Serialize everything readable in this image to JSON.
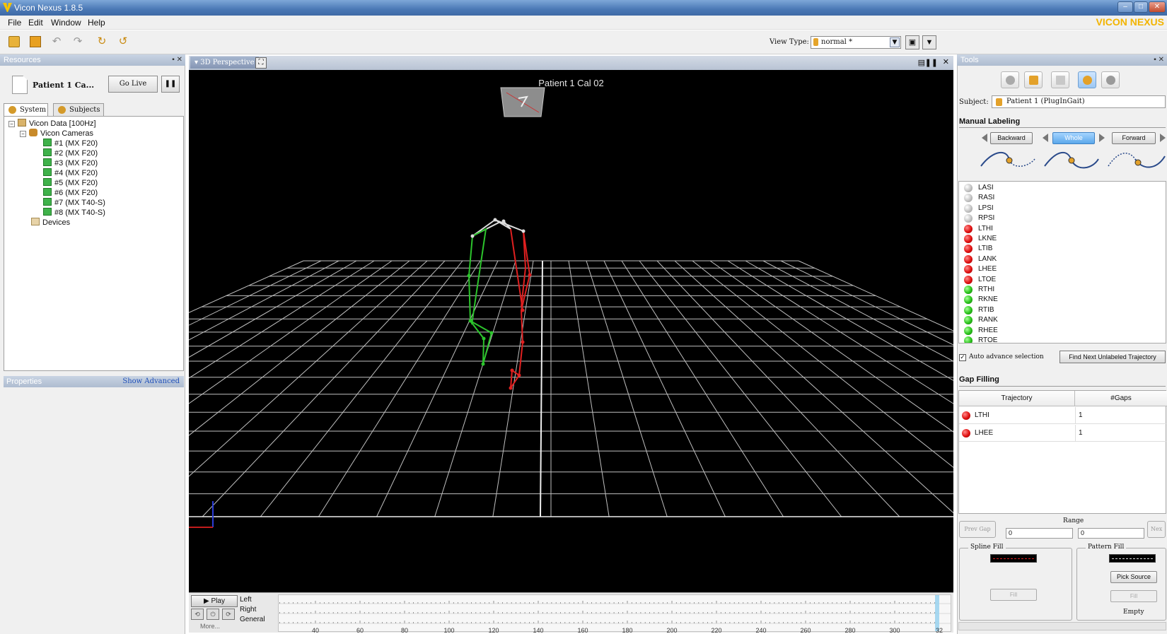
{
  "window": {
    "title": "Vicon Nexus 1.8.5",
    "buttons": [
      "–",
      "□",
      "✕"
    ]
  },
  "menu": [
    "File",
    "Edit",
    "Window",
    "Help"
  ],
  "brand": "VICON NEXUS",
  "toolbar": {
    "view_type_label": "View Type:",
    "view_type_value": "normal *"
  },
  "resources": {
    "header": "Resources",
    "patient_label": "Patient 1 Ca...",
    "go_live": "Go Live",
    "pause_icon": "pause-icon",
    "tabs": [
      "System",
      "Subjects"
    ],
    "tree": {
      "root": "Vicon Data [100Hz]",
      "cameras_label": "Vicon Cameras",
      "cameras": [
        "#1 (MX F20)",
        "#2 (MX F20)",
        "#3 (MX F20)",
        "#4 (MX F20)",
        "#5 (MX F20)",
        "#6 (MX F20)",
        "#7 (MX T40-S)",
        "#8 (MX T40-S)"
      ],
      "devices": "Devices"
    }
  },
  "properties": {
    "header": "Properties",
    "show_advanced": "Show Advanced"
  },
  "viewport": {
    "tab": "3D Perspective",
    "title": "Patient 1 Cal 02"
  },
  "timeline": {
    "play": "Play",
    "tracks": [
      "Left",
      "Right",
      "General"
    ],
    "more": "More...",
    "ticks": [
      "40",
      "60",
      "80",
      "100",
      "120",
      "140",
      "160",
      "180",
      "200",
      "220",
      "240",
      "260",
      "280",
      "300",
      "32"
    ]
  },
  "tools": {
    "header": "Tools",
    "subject_label": "Subject:",
    "subject_value": "Patient 1 (PlugInGait)",
    "manual_labeling": "Manual Labeling",
    "direction_buttons": [
      "Backward",
      "Whole",
      "Forward"
    ],
    "markers": [
      {
        "name": "LASI",
        "color": "gray"
      },
      {
        "name": "RASI",
        "color": "gray"
      },
      {
        "name": "LPSI",
        "color": "gray"
      },
      {
        "name": "RPSI",
        "color": "gray"
      },
      {
        "name": "LTHI",
        "color": "red"
      },
      {
        "name": "LKNE",
        "color": "red"
      },
      {
        "name": "LTIB",
        "color": "red"
      },
      {
        "name": "LANK",
        "color": "red"
      },
      {
        "name": "LHEE",
        "color": "red"
      },
      {
        "name": "LTOE",
        "color": "red"
      },
      {
        "name": "RTHI",
        "color": "green"
      },
      {
        "name": "RKNE",
        "color": "green"
      },
      {
        "name": "RTIB",
        "color": "green"
      },
      {
        "name": "RANK",
        "color": "green"
      },
      {
        "name": "RHEE",
        "color": "green"
      },
      {
        "name": "RTOE",
        "color": "green"
      }
    ],
    "auto_advance": "Auto advance selection",
    "find_next": "Find Next Unlabeled Trajectory",
    "gap_filling": "Gap Filling",
    "gap_table": {
      "headers": [
        "Trajectory",
        "#Gaps"
      ],
      "rows": [
        {
          "name": "LTHI",
          "gaps": "1"
        },
        {
          "name": "LHEE",
          "gaps": "1"
        }
      ]
    },
    "prev_gap": "Prev Gap",
    "next_gap": "Nex",
    "range_label": "Range",
    "range_from": "0",
    "range_to": "0",
    "spline_fill": "Spline Fill",
    "pattern_fill": "Pattern Fill",
    "pick_source": "Pick Source",
    "fill": "Fill",
    "empty": "Empty"
  },
  "colors": {
    "left_segment": "#e02020",
    "right_segment": "#2cc42c",
    "accent": "#f2b400"
  }
}
